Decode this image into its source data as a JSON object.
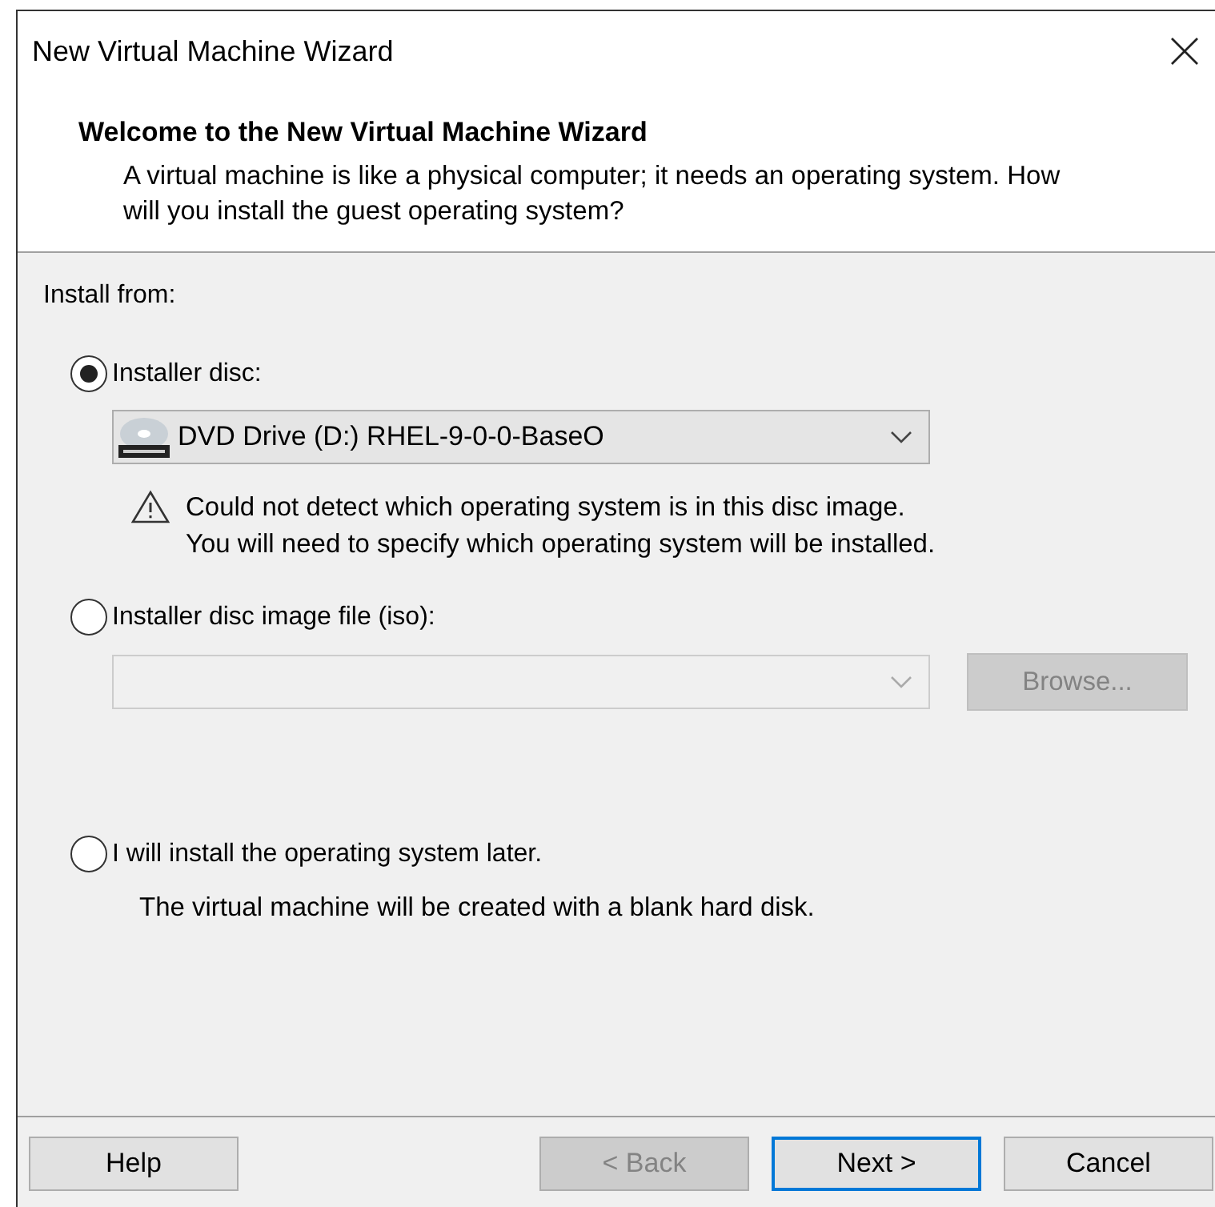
{
  "window": {
    "title": "New Virtual Machine Wizard"
  },
  "header": {
    "title": "Welcome to the New Virtual Machine Wizard",
    "description": "A virtual machine is like a physical computer; it needs an operating system. How will you install the guest operating system?"
  },
  "install_from": "Install from:",
  "options": [
    {
      "kind": "disc",
      "label": "Installer disc:",
      "selected": true,
      "combo": {
        "value": "DVD Drive (D:) RHEL-9-0-0-BaseO",
        "disabled": false
      },
      "warning": [
        "Could not detect which operating system is in this disc image.",
        "You will need to specify which operating system will be installed."
      ]
    },
    {
      "kind": "iso",
      "label": "Installer disc image file (iso):",
      "selected": false,
      "combo": {
        "disabled": true
      },
      "browse": {
        "label": "Browse...",
        "disabled": true
      }
    },
    {
      "kind": "later",
      "label": "I will install the operating system later.",
      "selected": false,
      "note": "The virtual machine will be created with a blank hard disk."
    }
  ],
  "buttons": [
    {
      "label": "Help",
      "disabled": false,
      "default": false
    },
    {
      "label": "< Back",
      "disabled": true,
      "default": false
    },
    {
      "label": "Next >",
      "disabled": false,
      "default": true
    },
    {
      "label": "Cancel",
      "disabled": false,
      "default": false
    }
  ]
}
